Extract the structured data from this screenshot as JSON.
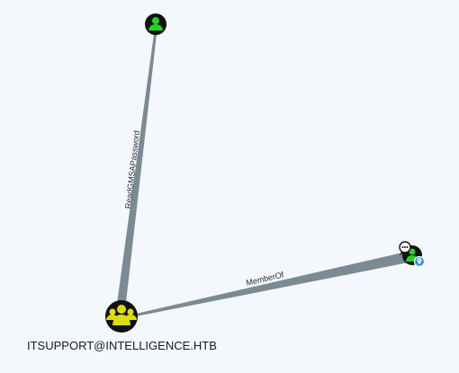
{
  "graph": {
    "nodes": [
      {
        "id": "user-top",
        "kind": "user",
        "label": "",
        "icon": "user-icon",
        "badge_color": "#22d422"
      },
      {
        "id": "itsupport-group",
        "kind": "group",
        "label": "ITSUPPORT@INTELLIGENCE.HTB",
        "icon": "group-icon",
        "badge_color": "#e0dd00"
      },
      {
        "id": "gmsa-account",
        "kind": "user",
        "label": "",
        "icon": "user-icon",
        "badge_color": "#22d422",
        "extra_icons": [
          "chat-bubble-icon",
          "location-pin-icon"
        ]
      }
    ],
    "edges": [
      {
        "from": "itsupport-group",
        "to": "user-top",
        "label": "ReadGMSAPassword"
      },
      {
        "from": "itsupport-group",
        "to": "gmsa-account",
        "label": "MemberOf"
      }
    ],
    "colors": {
      "background": "#f4f7fb",
      "edge": "#7b8a93",
      "node_fill": "#111111",
      "user_badge": "#22d422",
      "group_badge": "#e0dd00",
      "pin_badge": "#2b8cf0"
    }
  }
}
